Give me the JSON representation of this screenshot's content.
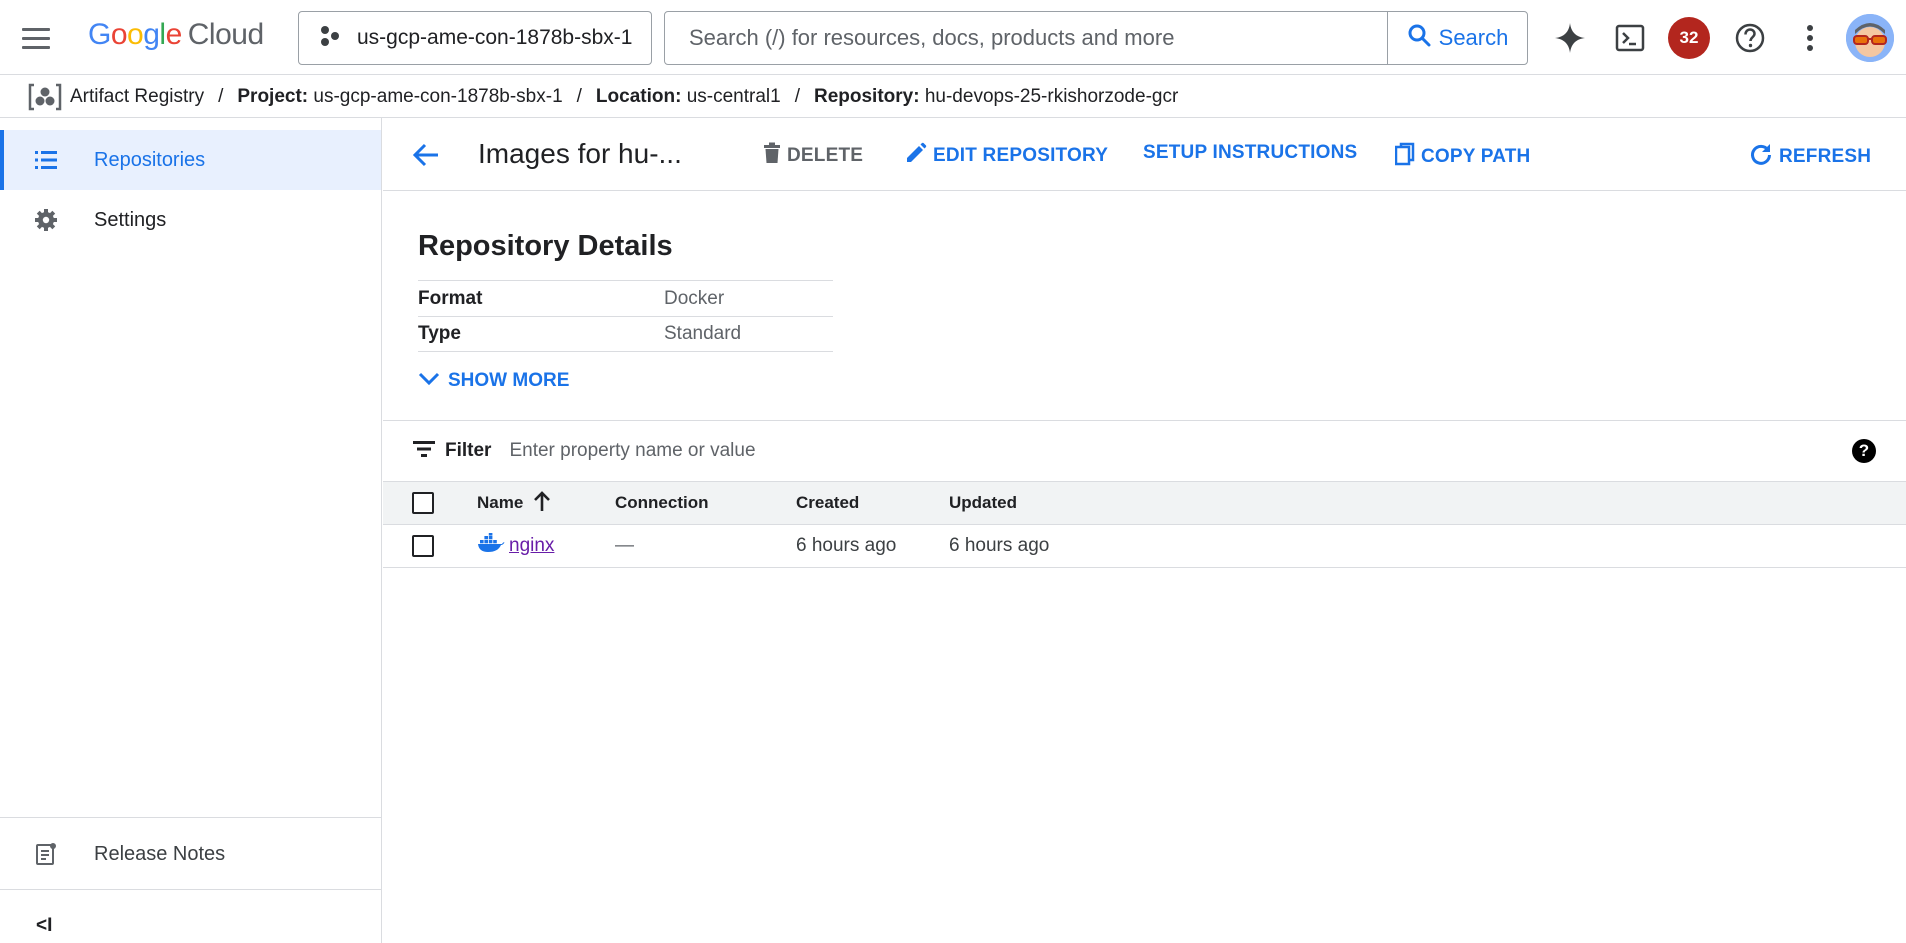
{
  "topbar": {
    "logo": {
      "google": [
        "G",
        "o",
        "o",
        "g",
        "l",
        "e"
      ],
      "cloud": "Cloud"
    },
    "project": "us-gcp-ame-con-1878b-sbx-1",
    "search_placeholder": "Search (/) for resources, docs, products and more",
    "search_button": "Search",
    "notification_count": "32",
    "icons": [
      "menu-icon",
      "project-icon",
      "search-icon",
      "gemini-icon",
      "cloud-shell-icon",
      "help-icon",
      "more-vert-icon"
    ]
  },
  "breadcrumb": {
    "service": "Artifact Registry",
    "project_label": "Project:",
    "project_value": "us-gcp-ame-con-1878b-sbx-1",
    "location_label": "Location:",
    "location_value": "us-central1",
    "repository_label": "Repository:",
    "repository_value": "hu-devops-25-rkishorzode-gcr",
    "separator": "/"
  },
  "sidebar": {
    "items": [
      {
        "label": "Repositories",
        "icon": "list-icon",
        "active": true
      },
      {
        "label": "Settings",
        "icon": "gear-icon",
        "active": false
      }
    ],
    "release_notes": "Release Notes",
    "collapse": "<I"
  },
  "header": {
    "title": "Images for hu-...",
    "actions": {
      "delete": "DELETE",
      "edit": "EDIT REPOSITORY",
      "setup": "SETUP INSTRUCTIONS",
      "copy": "COPY PATH",
      "refresh": "REFRESH"
    }
  },
  "details": {
    "title": "Repository Details",
    "rows": [
      {
        "key": "Format",
        "value": "Docker"
      },
      {
        "key": "Type",
        "value": "Standard"
      }
    ],
    "show_more": "SHOW MORE"
  },
  "filter": {
    "label": "Filter",
    "placeholder": "Enter property name or value",
    "help": "?"
  },
  "table": {
    "columns": [
      "Name",
      "Connection",
      "Created",
      "Updated"
    ],
    "rows": [
      {
        "name": "nginx",
        "connection": "—",
        "created": "6 hours ago",
        "updated": "6 hours ago"
      }
    ]
  },
  "colors": {
    "accent": "#1a73e8",
    "active_bg": "#e8f0fe",
    "badge": "#b3261e",
    "link_visited": "#681da8"
  }
}
